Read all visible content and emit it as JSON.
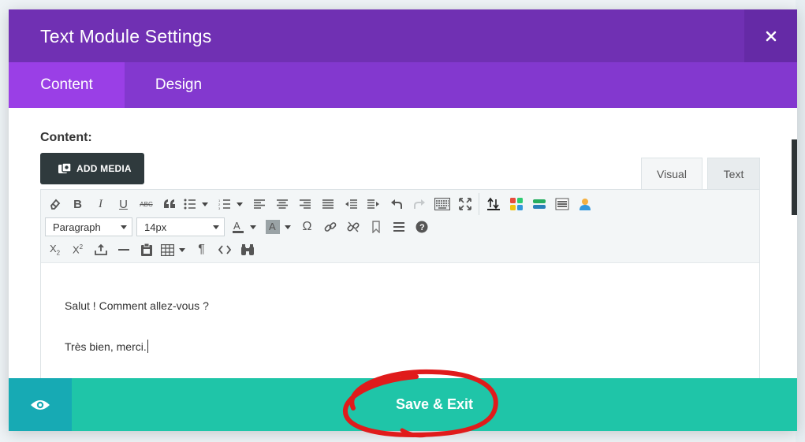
{
  "modal": {
    "title": "Text Module Settings",
    "close_glyph": "✕",
    "tabs": [
      {
        "label": "Content",
        "active": true
      },
      {
        "label": "Design",
        "active": false
      }
    ]
  },
  "content_section": {
    "label": "Content:",
    "add_media_label": "ADD MEDIA",
    "editor_tabs": [
      {
        "label": "Visual",
        "active": true
      },
      {
        "label": "Text",
        "active": false
      }
    ],
    "format_select": "Paragraph",
    "size_select": "14px",
    "body_paragraphs": [
      "Salut ! Comment allez-vous ?",
      "Très bien, merci."
    ],
    "toolbar_icons": [
      "eraser-icon",
      "bold-icon",
      "italic-icon",
      "underline-icon",
      "strikethrough-icon",
      "blockquote-icon",
      "bullet-list-icon",
      "numbered-list-icon",
      "align-left-icon",
      "align-center-icon",
      "align-right-icon",
      "justify-icon",
      "indent-icon",
      "outdent-icon",
      "undo-icon",
      "redo-icon",
      "keyboard-icon",
      "fullscreen-icon",
      "text-color-icon",
      "background-color-icon",
      "omega-icon",
      "link-icon",
      "unlink-icon",
      "bookmark-icon",
      "hr-icon",
      "help-icon",
      "subscript-icon",
      "superscript-icon",
      "insert-icon",
      "minus-icon",
      "paste-icon",
      "table-icon",
      "paragraph-icon",
      "code-icon",
      "find-icon"
    ]
  },
  "footer": {
    "save_label": "Save & Exit",
    "eye_icon": "eye-icon"
  },
  "colors": {
    "header": "#7030b3",
    "tabs_bar": "#8338cf",
    "active_tab": "#9a3fe6",
    "footer": "#1fc5a8",
    "eye_button": "#17aab4",
    "annotation": "#e01b1b"
  }
}
